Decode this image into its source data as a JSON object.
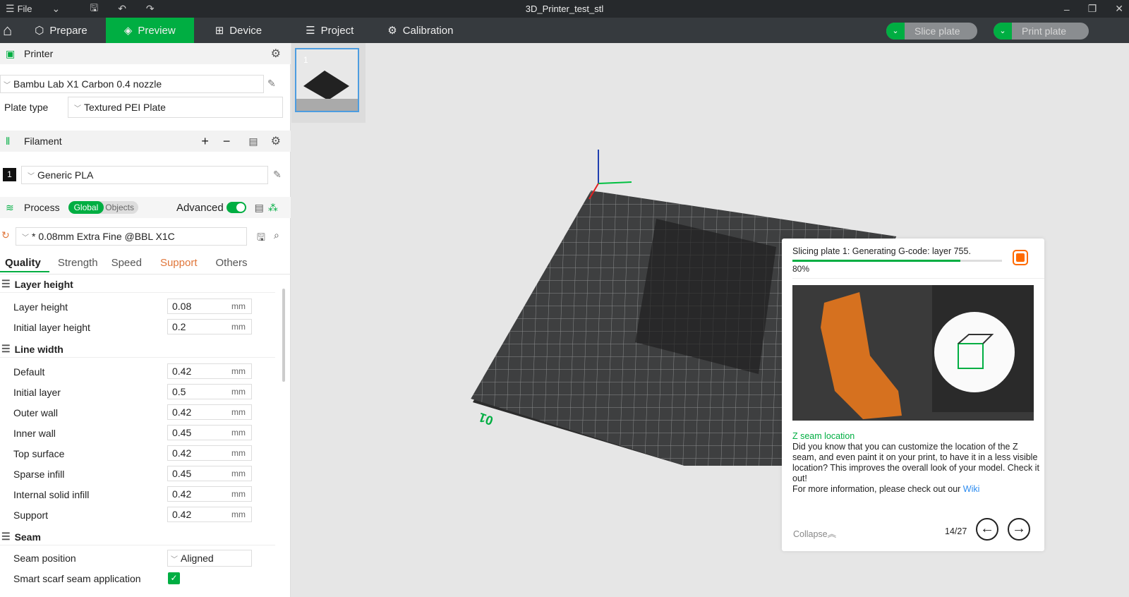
{
  "window": {
    "title": "3D_Printer_test_stl",
    "file_menu": "File"
  },
  "nav": {
    "tabs": [
      {
        "label": "Prepare",
        "icon": "cube-icon"
      },
      {
        "label": "Preview",
        "icon": "layers-icon",
        "active": true
      },
      {
        "label": "Device",
        "icon": "device-icon"
      },
      {
        "label": "Project",
        "icon": "list-icon"
      },
      {
        "label": "Calibration",
        "icon": "calibration-icon"
      }
    ],
    "slice_label": "Slice plate",
    "print_label": "Print plate"
  },
  "printer": {
    "heading": "Printer",
    "model": "Bambu Lab X1 Carbon 0.4 nozzle",
    "plate_type_label": "Plate type",
    "plate_type": "Textured PEI Plate"
  },
  "filament": {
    "heading": "Filament",
    "slot": "1",
    "name": "Generic PLA"
  },
  "process": {
    "heading": "Process",
    "global": "Global",
    "objects": "Objects",
    "advanced": "Advanced",
    "advanced_on": true,
    "profile": "* 0.08mm Extra Fine @BBL X1C"
  },
  "tabs": [
    "Quality",
    "Strength",
    "Speed",
    "Support",
    "Others"
  ],
  "layer_height": {
    "title": "Layer height",
    "rows": [
      {
        "label": "Layer height",
        "value": "0.08",
        "unit": "mm"
      },
      {
        "label": "Initial layer height",
        "value": "0.2",
        "unit": "mm"
      }
    ]
  },
  "line_width": {
    "title": "Line width",
    "rows": [
      {
        "label": "Default",
        "value": "0.42",
        "unit": "mm"
      },
      {
        "label": "Initial layer",
        "value": "0.5",
        "unit": "mm"
      },
      {
        "label": "Outer wall",
        "value": "0.42",
        "unit": "mm"
      },
      {
        "label": "Inner wall",
        "value": "0.45",
        "unit": "mm"
      },
      {
        "label": "Top surface",
        "value": "0.42",
        "unit": "mm"
      },
      {
        "label": "Sparse infill",
        "value": "0.45",
        "unit": "mm"
      },
      {
        "label": "Internal solid infill",
        "value": "0.42",
        "unit": "mm"
      },
      {
        "label": "Support",
        "value": "0.42",
        "unit": "mm"
      }
    ]
  },
  "seam": {
    "title": "Seam",
    "position_label": "Seam position",
    "position": "Aligned",
    "scarf_label": "Smart scarf seam application",
    "scarf_checked": true
  },
  "plate": {
    "number": "1",
    "label": "01"
  },
  "popup": {
    "status": "Slicing plate 1: Generating G-code: layer 755.",
    "progress_percent": 80,
    "progress_text": "80%",
    "tip_title": "Z seam location",
    "tip_body": "Did you know that you can customize the location of the Z seam, and even paint it on your print, to have it in a less visible location? This improves the overall look of your model. Check it out!",
    "more_info": "For more information, please check out our ",
    "wiki": "Wiki",
    "collapse": "Collapse",
    "page": "14/27"
  },
  "colors": {
    "accent": "#00ae42",
    "support_tab": "#e0763a",
    "stop": "#ff6a00",
    "link": "#2d8cf0"
  }
}
